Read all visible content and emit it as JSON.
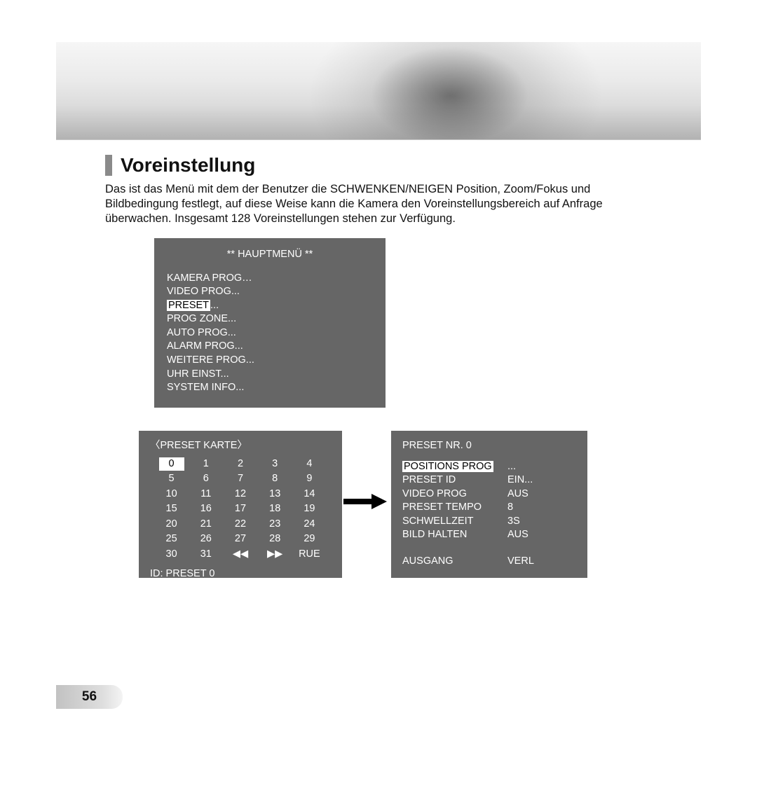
{
  "heading": "Voreinstellung",
  "body": "Das ist das Menü mit dem der Benutzer die SCHWENKEN/NEIGEN Position, Zoom/Fokus und Bildbedingung festlegt, auf diese Weise kann die Kamera den Voreinstellungsbereich auf Anfrage überwachen. Insgesamt 128 Voreinstellungen stehen zur Verfügung.",
  "main_menu": {
    "title": "** HAUPTMENÜ **",
    "items": [
      "KAMERA PROG…",
      "VIDEO PROG...",
      "PRESET...",
      "PROG ZONE...",
      "AUTO PROG...",
      "ALARM PROG...",
      "WEITERE PROG...",
      "UHR EINST...",
      "SYSTEM INFO..."
    ],
    "highlight_prefix": "PRESET",
    "highlight_suffix": "..."
  },
  "preset_map": {
    "title": "〈PRESET KARTE〉",
    "grid": [
      [
        "0",
        "1",
        "2",
        "3",
        "4"
      ],
      [
        "5",
        "6",
        "7",
        "8",
        "9"
      ],
      [
        "10",
        "11",
        "12",
        "13",
        "14"
      ],
      [
        "15",
        "16",
        "17",
        "18",
        "19"
      ],
      [
        "20",
        "21",
        "22",
        "23",
        "24"
      ],
      [
        "25",
        "26",
        "27",
        "28",
        "29"
      ],
      [
        "30",
        "31",
        "◀◀",
        "▶▶",
        "RUE"
      ]
    ],
    "selected": "0",
    "id_line": "ID: PRESET 0"
  },
  "preset_detail": {
    "title": "PRESET NR.   0",
    "rows": [
      {
        "label": "POSITIONS PROG",
        "value": "...",
        "highlight": true
      },
      {
        "label": "PRESET ID",
        "value": "EIN..."
      },
      {
        "label": "VIDEO PROG",
        "value": "AUS"
      },
      {
        "label": "PRESET TEMPO",
        "value": "8"
      },
      {
        "label": "SCHWELLZEIT",
        "value": "3S"
      },
      {
        "label": "BILD HALTEN",
        "value": "AUS"
      }
    ],
    "exit": {
      "label": "AUSGANG",
      "value": "VERL"
    }
  },
  "page_number": "56"
}
